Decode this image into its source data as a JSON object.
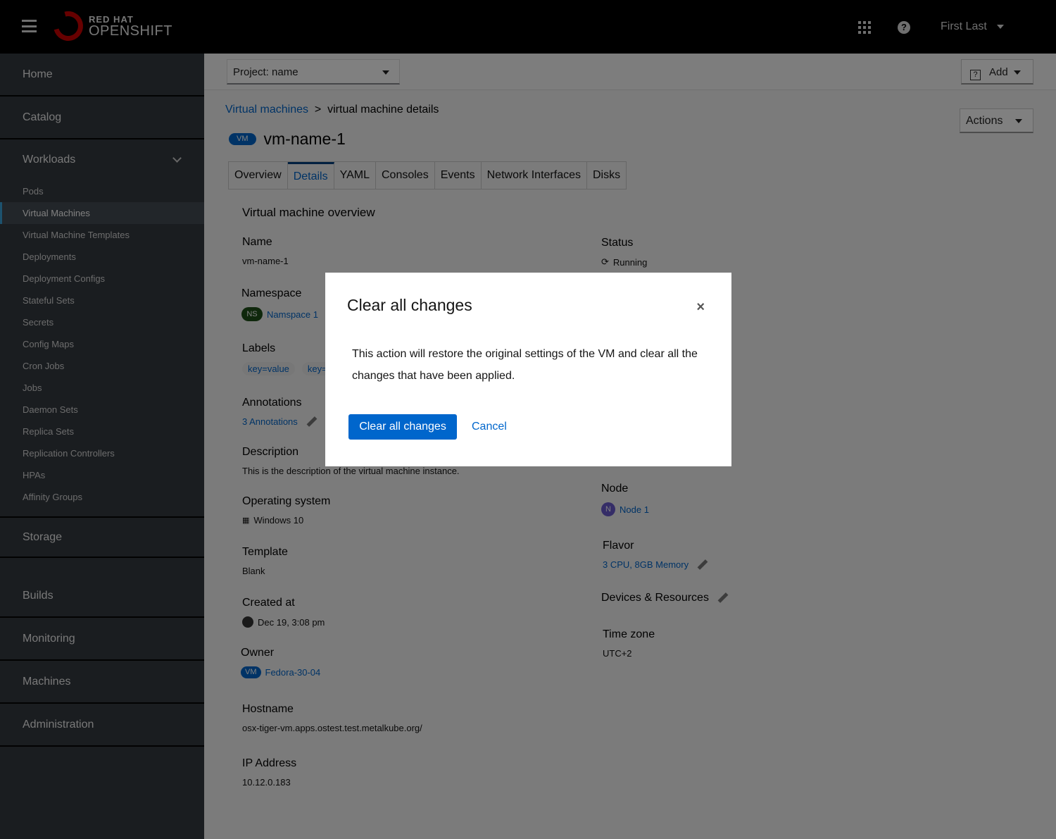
{
  "topbar": {
    "brand_line1": "RED HAT",
    "brand_line2": "OPENSHIFT",
    "user": "First Last"
  },
  "sidebar": {
    "home": "Home",
    "catalog": "Catalog",
    "workloads": "Workloads",
    "workload_items": [
      "Pods",
      "Virtual Machines",
      "Virtual Machine Templates",
      "Deployments",
      "Deployment Configs",
      "Stateful Sets",
      "Secrets",
      "Config Maps",
      "Cron Jobs",
      "Jobs",
      "Daemon Sets",
      "Replica Sets",
      "Replication Controllers",
      "HPAs",
      "Affinity Groups"
    ],
    "active_item": "Virtual Machines",
    "storage": "Storage",
    "builds": "Builds",
    "monitoring": "Monitoring",
    "machines": "Machines",
    "administration": "Administration"
  },
  "projbar": {
    "project": "Project: name",
    "add": "Add"
  },
  "breadcrumb": {
    "parent": "Virtual machines",
    "sep": ">",
    "current": "virtual machine details"
  },
  "header": {
    "badge": "VM",
    "name": "vm-name-1",
    "actions": "Actions"
  },
  "tabs": [
    "Overview",
    "Details",
    "YAML",
    "Consoles",
    "Events",
    "Network Interfaces",
    "Disks"
  ],
  "active_tab": "Details",
  "details": {
    "section": "Virtual machine overview",
    "name_k": "Name",
    "name_v": "vm-name-1",
    "namespace_k": "Namespace",
    "namespace_badge": "NS",
    "namespace_v": "Namspace 1",
    "labels_k": "Labels",
    "labels": [
      "key=value",
      "key=v"
    ],
    "annotations_k": "Annotations",
    "annotations_v": "3 Annotations",
    "description_k": "Description",
    "description_v": "This is the description of the virtual machine instance.",
    "os_k": "Operating system",
    "os_v": "Windows 10",
    "template_k": "Template",
    "template_v": "Blank",
    "created_k": "Created at",
    "created_v": "Dec 19, 3:08 pm",
    "owner_k": "Owner",
    "owner_badge": "VM",
    "owner_v": "Fedora-30-04",
    "hostname_k": "Hostname",
    "hostname_v": "osx-tiger-vm.apps.ostest.test.metalkube.org/",
    "ip_k": "IP Address",
    "ip_v": "10.12.0.183",
    "status_k": "Status",
    "status_v": "Running",
    "node_k": "Node",
    "node_badge": "N",
    "node_v": "Node 1",
    "flavor_k": "Flavor",
    "flavor_v": "3 CPU, 8GB Memory",
    "devices_k": "Devices & Resources",
    "tz_k": "Time zone",
    "tz_v": "UTC+2"
  },
  "modal": {
    "title": "Clear all changes",
    "close": "×",
    "body": "This action will restore the original settings of the VM and clear all the changes that have been applied.",
    "confirm": "Clear all changes",
    "cancel": "Cancel"
  },
  "colors": {
    "primary": "#0066cc",
    "brand_red": "#cc0000",
    "sidebar": "#292e34"
  }
}
